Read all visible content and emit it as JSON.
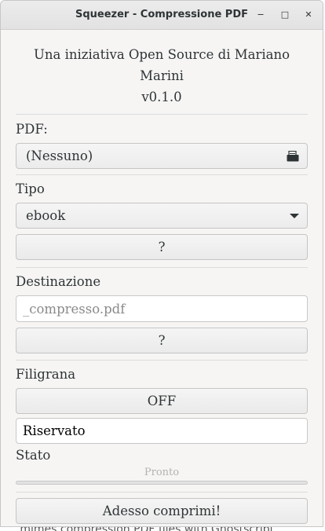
{
  "window": {
    "title": "Squeezer - Compressione PDF",
    "controls": {
      "minimize": "‒",
      "maximize": "□",
      "close": "✕"
    }
  },
  "header": {
    "line1": "Una iniziativa Open Source di Mariano Marini",
    "version": "v0.1.0"
  },
  "pdf": {
    "label": "PDF:",
    "file_value": "(Nessuno)",
    "icon": "open-file-icon"
  },
  "tipo": {
    "label": "Tipo",
    "selected": "ebook",
    "help_label": "?"
  },
  "destinazione": {
    "label": "Destinazione",
    "placeholder": "_compresso.pdf",
    "help_label": "?"
  },
  "filigrana": {
    "label": "Filigrana",
    "toggle_label": "OFF",
    "text_value": "Riservato"
  },
  "stato": {
    "label": "Stato",
    "status_text": "Pronto",
    "progress": 0
  },
  "actions": {
    "compress_label": "Adesso comprimi!"
  },
  "background": {
    "partial_text": "...mimes compression PDF files with Ghostscript"
  }
}
